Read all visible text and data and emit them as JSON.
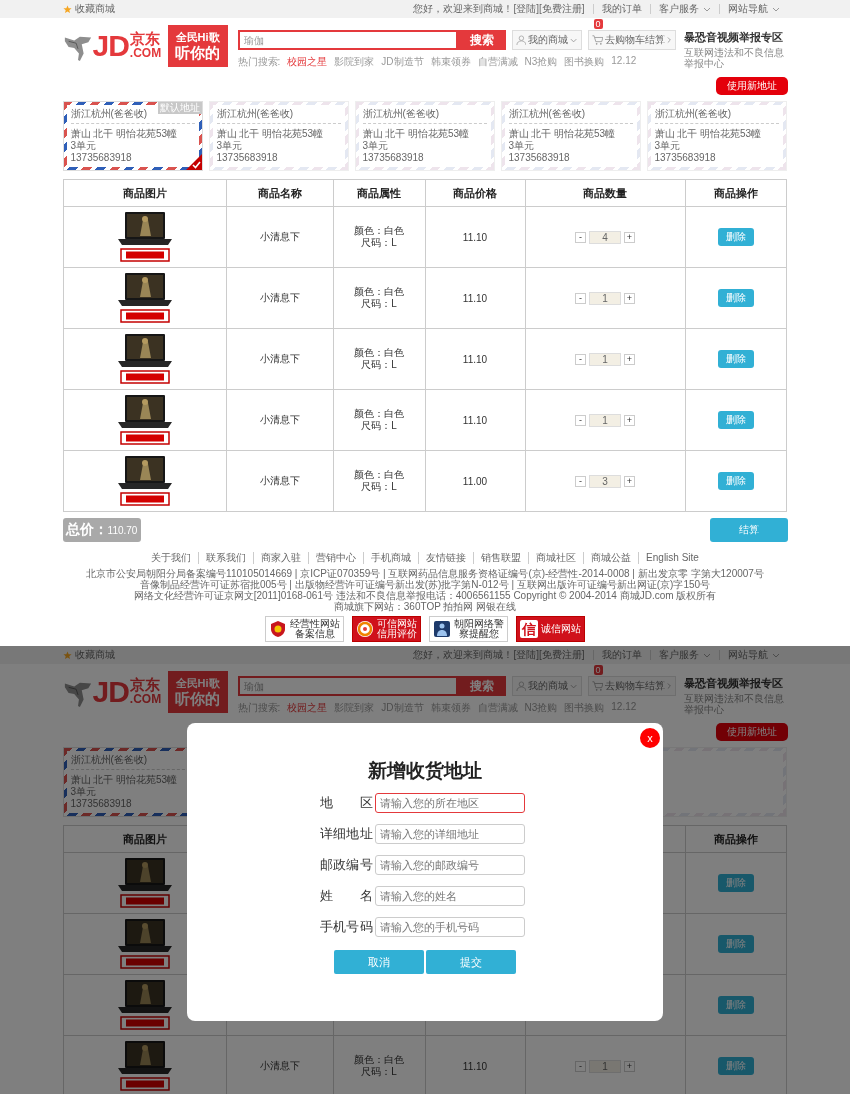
{
  "views": [
    {
      "top_bar": {
        "favorite": "收藏商城",
        "greeting": "您好，欢迎来到商城！",
        "login": "[登陆]",
        "register": "[免费注册]",
        "links": [
          {
            "label": "我的订单",
            "dropdown": false
          },
          {
            "label": "客户服务",
            "dropdown": true
          },
          {
            "label": "网站导航",
            "dropdown": true
          }
        ]
      },
      "header": {
        "logo": {
          "mark": "JD",
          "name": "京东",
          "domain": ".COM"
        },
        "banner": [
          "全民Hi歌",
          "听你的"
        ],
        "search": {
          "placeholder": "瑜伽",
          "button": "搜索"
        },
        "hot_search": {
          "label": "热门搜索:",
          "items": [
            {
              "text": "校园之星",
              "highlighted": true
            },
            {
              "text": "影院到家",
              "highlighted": false
            },
            {
              "text": "JD制造节",
              "highlighted": false
            },
            {
              "text": "韩束领券",
              "highlighted": false
            },
            {
              "text": "自营满减",
              "highlighted": false
            },
            {
              "text": "N3抢购",
              "highlighted": false
            },
            {
              "text": "图书换购",
              "highlighted": false
            },
            {
              "text": "12.12",
              "highlighted": false
            }
          ]
        },
        "my_mall": "我的商城",
        "cart": {
          "label": "去购物车结算",
          "count": "0"
        },
        "report": {
          "title": "暴恐音视频举报专区",
          "subtitle": "互联网违法和不良信息举报中心"
        }
      },
      "new_address_button": "使用新地址",
      "address_cards": [
        {
          "region": "浙江杭州(爸爸收)",
          "address": "萧山 北干 明怡花苑53幢3单元",
          "phone": "13735683918",
          "selected": true,
          "default_label": "默认地址"
        },
        {
          "region": "浙江杭州(爸爸收)",
          "address": "萧山 北干 明怡花苑53幢3单元",
          "phone": "13735683918",
          "selected": false
        },
        {
          "region": "浙江杭州(爸爸收)",
          "address": "萧山 北干 明怡花苑53幢3单元",
          "phone": "13735683918",
          "selected": false
        },
        {
          "region": "浙江杭州(爸爸收)",
          "address": "萧山 北干 明怡花苑53幢3单元",
          "phone": "13735683918",
          "selected": false
        },
        {
          "region": "浙江杭州(爸爸收)",
          "address": "萧山 北干 明怡花苑53幢3单元",
          "phone": "13735683918",
          "selected": false
        }
      ],
      "cart_table": {
        "columns": [
          {
            "label": "商品图片"
          },
          {
            "label": "商品名称"
          },
          {
            "label": "商品属性"
          },
          {
            "label": "商品价格"
          },
          {
            "label": "商品数量"
          },
          {
            "label": "商品操作"
          }
        ],
        "rows": [
          {
            "name": "小清息下",
            "attributes": [
              "颜色：白色",
              "尺码：L"
            ],
            "price": "11.10",
            "quantity": {
              "minus": "-",
              "value": "4",
              "plus": "+"
            },
            "action": "删除"
          },
          {
            "name": "小清息下",
            "attributes": [
              "颜色：白色",
              "尺码：L"
            ],
            "price": "11.10",
            "quantity": {
              "minus": "-",
              "value": "1",
              "plus": "+"
            },
            "action": "删除"
          },
          {
            "name": "小清息下",
            "attributes": [
              "颜色：白色",
              "尺码：L"
            ],
            "price": "11.10",
            "quantity": {
              "minus": "-",
              "value": "1",
              "plus": "+"
            },
            "action": "删除"
          },
          {
            "name": "小清息下",
            "attributes": [
              "颜色：白色",
              "尺码：L"
            ],
            "price": "11.10",
            "quantity": {
              "minus": "-",
              "value": "1",
              "plus": "+"
            },
            "action": "删除"
          },
          {
            "name": "小清息下",
            "attributes": [
              "颜色：白色",
              "尺码：L"
            ],
            "price": "11.00",
            "quantity": {
              "minus": "-",
              "value": "3",
              "plus": "+"
            },
            "action": "删除"
          }
        ]
      },
      "summary": {
        "total_label": "总价：",
        "total": "110.70",
        "checkout": "结算"
      },
      "footer": {
        "links": [
          "关于我们",
          "联系我们",
          "商家入驻",
          "营销中心",
          "手机商城",
          "友情链接",
          "销售联盟",
          "商城社区",
          "商城公益",
          "English Site"
        ],
        "lines": [
          "北京市公安局朝阳分局备案编号110105014669 | 京ICP证070359号 | 互联网药品信息服务资格证编号(京)-经营性-2014-0008 | 新出发京零 字第大120007号",
          "音像制品经营许可证苏宿批005号 | 出版物经营许可证编号新出发(苏)批字第N-012号 | 互联网出版许可证编号新出网证(京)字150号",
          "网络文化经营许可证京网文[2011]0168-061号 违法和不良信息举报电话：4006561155 Copyright © 2004-2014 商城JD.com 版权所有",
          "商城旗下网站：360TOP 拍拍网 网银在线"
        ],
        "badges": [
          {
            "kind": "record",
            "lines": [
              "经营性网站",
              "备案信息"
            ]
          },
          {
            "kind": "trusted",
            "lines": [
              "可信网站",
              "信用评价"
            ]
          },
          {
            "kind": "police",
            "lines": [
              "朝阳网络警",
              "察提醒您"
            ]
          },
          {
            "kind": "integrity",
            "emblem": "信",
            "lines": [
              "诚信网站"
            ]
          }
        ]
      }
    },
    {
      "top_bar": {
        "favorite": "收藏商城",
        "greeting": "您好，欢迎来到商城！",
        "login": "[登陆]",
        "register": "[免费注册]",
        "links": [
          {
            "label": "我的订单",
            "dropdown": false
          },
          {
            "label": "客户服务",
            "dropdown": true
          },
          {
            "label": "网站导航",
            "dropdown": true
          }
        ]
      },
      "header": {
        "logo": {
          "mark": "JD",
          "name": "京东",
          "domain": ".COM"
        },
        "banner": [
          "全民Hi歌",
          "听你的"
        ],
        "search": {
          "placeholder": "瑜伽",
          "button": "搜索"
        },
        "hot_search": {
          "label": "热门搜索:",
          "items": [
            {
              "text": "校园之星",
              "highlighted": true
            },
            {
              "text": "影院到家",
              "highlighted": false
            },
            {
              "text": "JD制造节",
              "highlighted": false
            },
            {
              "text": "韩束领券",
              "highlighted": false
            },
            {
              "text": "自营满减",
              "highlighted": false
            },
            {
              "text": "N3抢购",
              "highlighted": false
            },
            {
              "text": "图书换购",
              "highlighted": false
            },
            {
              "text": "12.12",
              "highlighted": false
            }
          ]
        },
        "my_mall": "我的商城",
        "cart": {
          "label": "去购物车结算",
          "count": "0"
        },
        "report": {
          "title": "暴恐音视频举报专区",
          "subtitle": "互联网违法和不良信息举报中心"
        }
      },
      "new_address_button": "使用新地址",
      "address_cards": [
        {
          "region": "浙江杭州(爸爸收)",
          "address": "萧山 北干 明怡花苑53幢3单元",
          "phone": "13735683918",
          "selected": true
        }
      ],
      "cart_table": {
        "columns": [
          {
            "label": "商品图片"
          },
          {},
          {},
          {},
          {},
          {
            "label": "商品操作"
          }
        ],
        "rows": [
          {
            "action": "删除"
          },
          {
            "action": "删除"
          },
          {
            "action": "删除"
          },
          {
            "name": "小清息下",
            "attributes": [
              "颜色：白色",
              "尺码：L"
            ],
            "price": "11.10",
            "quantity": {
              "minus": "-",
              "value": "1",
              "plus": "+"
            },
            "action": "删除"
          }
        ]
      },
      "dialog": {
        "close": "x",
        "title": "新增收货地址",
        "fields": [
          {
            "label": "地区",
            "placeholder": "请输入您的所在地区",
            "focused": true
          },
          {
            "label": "详细地址",
            "placeholder": "请输入您的详细地址",
            "focused": false
          },
          {
            "label": "邮政编号",
            "placeholder": "请输入您的邮政编号",
            "focused": false
          },
          {
            "label": "姓名",
            "placeholder": "请输入您的姓名",
            "focused": false
          },
          {
            "label": "手机号码",
            "placeholder": "请输入您的手机号码",
            "focused": false
          }
        ],
        "buttons": [
          "取消",
          "提交"
        ]
      }
    }
  ]
}
